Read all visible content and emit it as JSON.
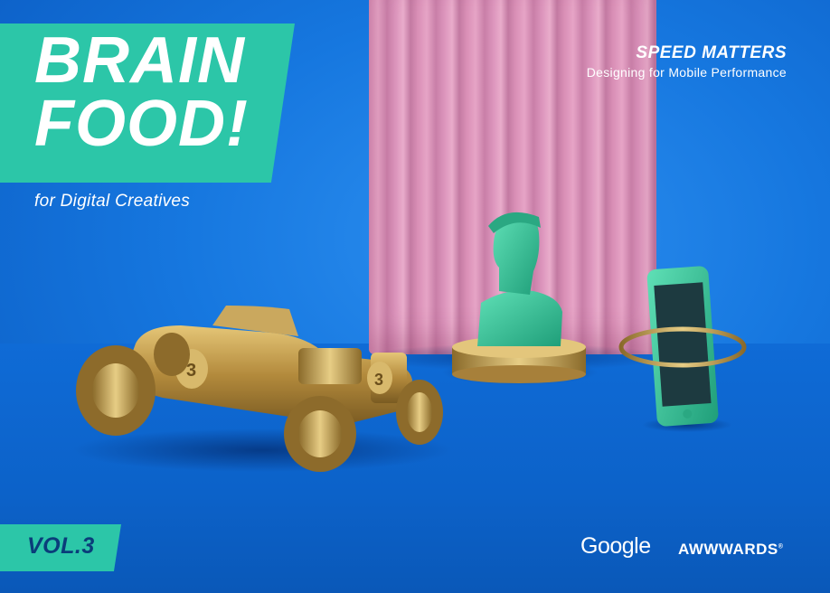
{
  "title": "BRAIN\nFOOD!",
  "subtitle": "for Digital Creatives",
  "headline": "SPEED MATTERS",
  "tagline": "Designing for Mobile Performance",
  "volume": "VOL.3",
  "logos": {
    "google": "Google",
    "awwwards": "AWWWARDS",
    "registered": "®"
  },
  "colors": {
    "background": "#1677df",
    "accent": "#2cc6a8",
    "curtain": "#d98fb6",
    "gold": "#c9a24a",
    "bust": "#34c79a"
  },
  "objects": {
    "car_number": "3"
  }
}
